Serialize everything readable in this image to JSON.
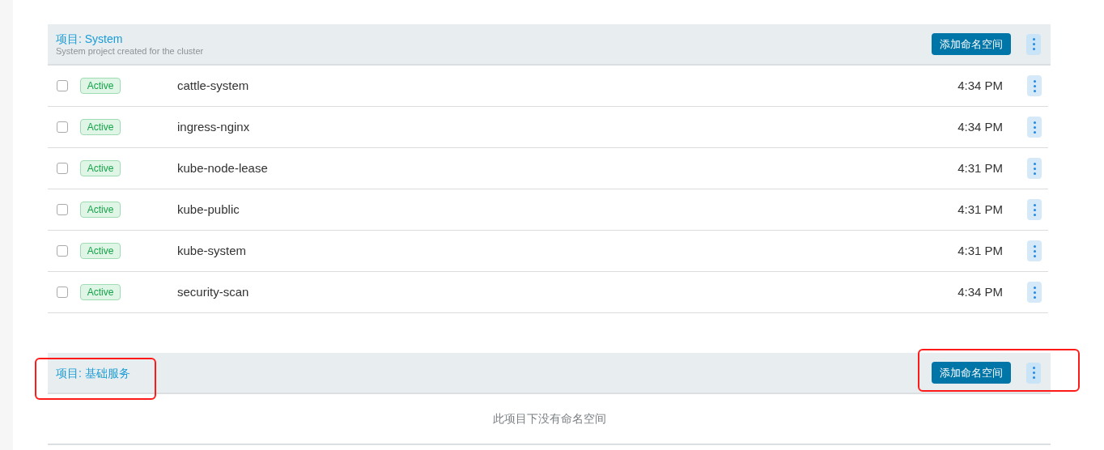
{
  "projects": [
    {
      "title": "项目: System",
      "description": "System project created for the cluster",
      "add_button": "添加命名空间",
      "namespaces": [
        {
          "checked": false,
          "state": "Active",
          "name": "cattle-system",
          "time": "4:34 PM"
        },
        {
          "checked": false,
          "state": "Active",
          "name": "ingress-nginx",
          "time": "4:34 PM"
        },
        {
          "checked": false,
          "state": "Active",
          "name": "kube-node-lease",
          "time": "4:31 PM"
        },
        {
          "checked": false,
          "state": "Active",
          "name": "kube-public",
          "time": "4:31 PM"
        },
        {
          "checked": false,
          "state": "Active",
          "name": "kube-system",
          "time": "4:31 PM"
        },
        {
          "checked": false,
          "state": "Active",
          "name": "security-scan",
          "time": "4:34 PM"
        }
      ]
    },
    {
      "title": "项目: 基础服务",
      "add_button": "添加命名空间",
      "empty_message": "此项目下没有命名空间",
      "highlighted": true
    }
  ]
}
